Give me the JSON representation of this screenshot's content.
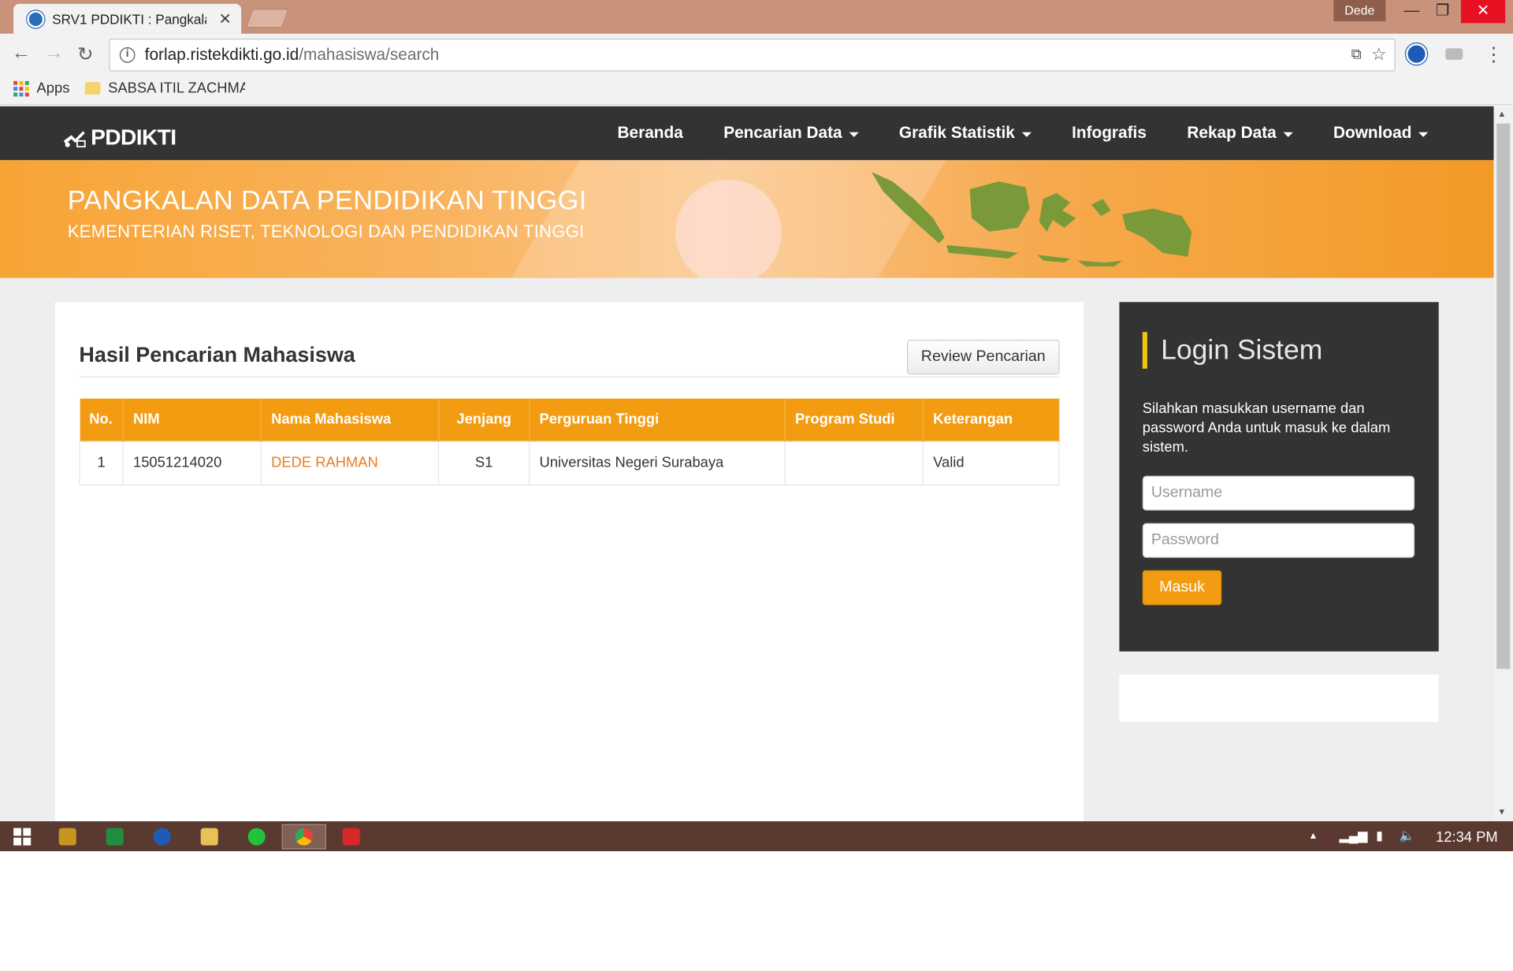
{
  "browser": {
    "tab_title": "SRV1 PDDIKTI : Pangkala",
    "profile_name": "Dede",
    "url_host": "forlap.ristekdikti.go.id",
    "url_path": "/mahasiswa/search",
    "bookmarks": [
      {
        "label": "Apps"
      },
      {
        "label": "SABSA ITIL ZACHMAN"
      }
    ]
  },
  "site": {
    "brand": "PDDIKTI",
    "nav": [
      {
        "label": "Beranda",
        "dropdown": false
      },
      {
        "label": "Pencarian Data",
        "dropdown": true
      },
      {
        "label": "Grafik Statistik",
        "dropdown": true
      },
      {
        "label": "Infografis",
        "dropdown": false
      },
      {
        "label": "Rekap Data",
        "dropdown": true
      },
      {
        "label": "Download",
        "dropdown": true
      }
    ],
    "banner_title": "PANGKALAN DATA PENDIDIKAN TINGGI",
    "banner_subtitle": "KEMENTERIAN RISET, TEKNOLOGI DAN PENDIDIKAN TINGGI"
  },
  "results": {
    "title": "Hasil Pencarian Mahasiswa",
    "review_button": "Review Pencarian",
    "columns": [
      "No.",
      "NIM",
      "Nama Mahasiswa",
      "Jenjang",
      "Perguruan Tinggi",
      "Program Studi",
      "Keterangan"
    ],
    "rows": [
      {
        "no": "1",
        "nim": "15051214020",
        "nama": "DEDE RAHMAN",
        "jenjang": "S1",
        "pt": "Universitas Negeri Surabaya",
        "prodi": "",
        "ket": "Valid"
      }
    ]
  },
  "login": {
    "title": "Login Sistem",
    "description": "Silahkan masukkan username dan password Anda untuk masuk ke dalam sistem.",
    "username_placeholder": "Username",
    "password_placeholder": "Password",
    "submit_label": "Masuk"
  },
  "taskbar": {
    "clock": "12:34 PM"
  },
  "colors": {
    "accent": "#f39c12",
    "navbar": "#333333",
    "link": "#e67e22"
  }
}
